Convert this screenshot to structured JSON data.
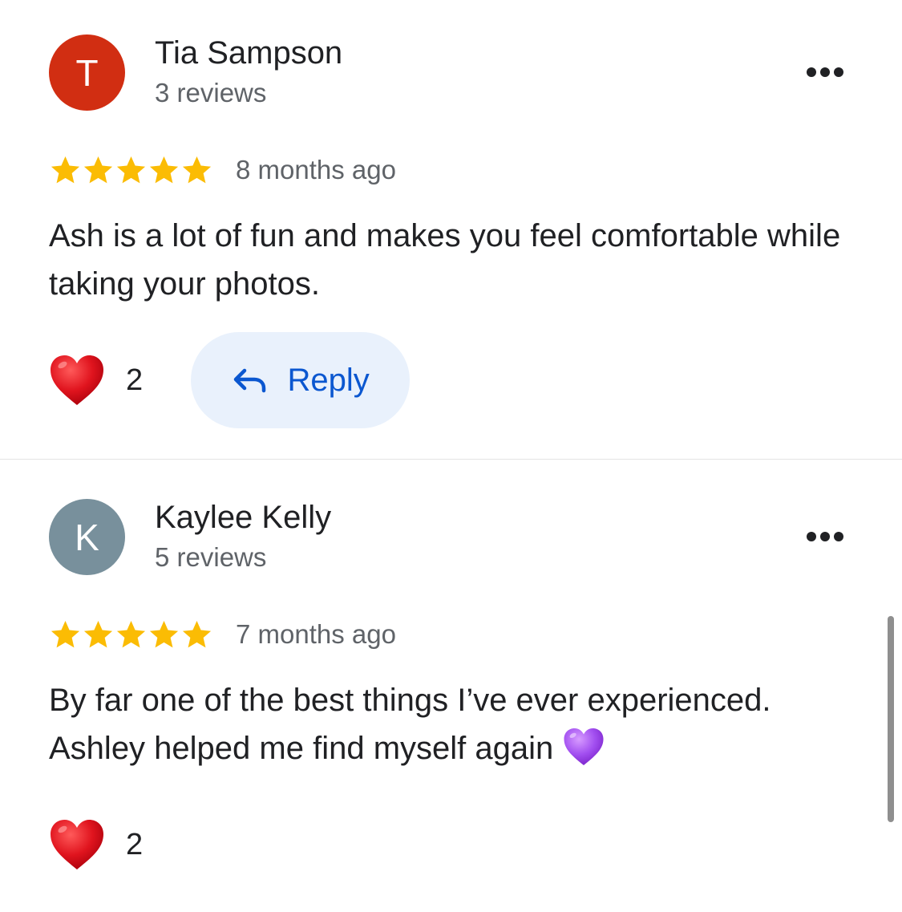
{
  "reviews": [
    {
      "avatar_initial": "T",
      "avatar_color": "#d12e12",
      "name": "Tia Sampson",
      "review_count": "3 reviews",
      "rating": 5,
      "date": "8 months ago",
      "text": "Ash is a lot of fun and makes you feel comfortable while taking your photos.",
      "emoji": "",
      "likes": "2",
      "reply_label": "Reply"
    },
    {
      "avatar_initial": "K",
      "avatar_color": "#78909c",
      "name": "Kaylee Kelly",
      "review_count": "5 reviews",
      "rating": 5,
      "date": "7 months ago",
      "text": "By far one of the best things I’ve ever  experienced. Ashley helped me find myself again",
      "emoji": "purple-heart-icon",
      "likes": "2"
    }
  ],
  "colors": {
    "star": "#fbbc04",
    "heart": "#e0141e",
    "purple_heart": "#a24ff0",
    "reply_text": "#0b57d0",
    "reply_bg": "#e9f1fc"
  },
  "icons": {
    "like": "red-heart-icon",
    "reply": "reply-arrow-icon",
    "more": "more-horizontal-icon",
    "star": "star-icon"
  }
}
